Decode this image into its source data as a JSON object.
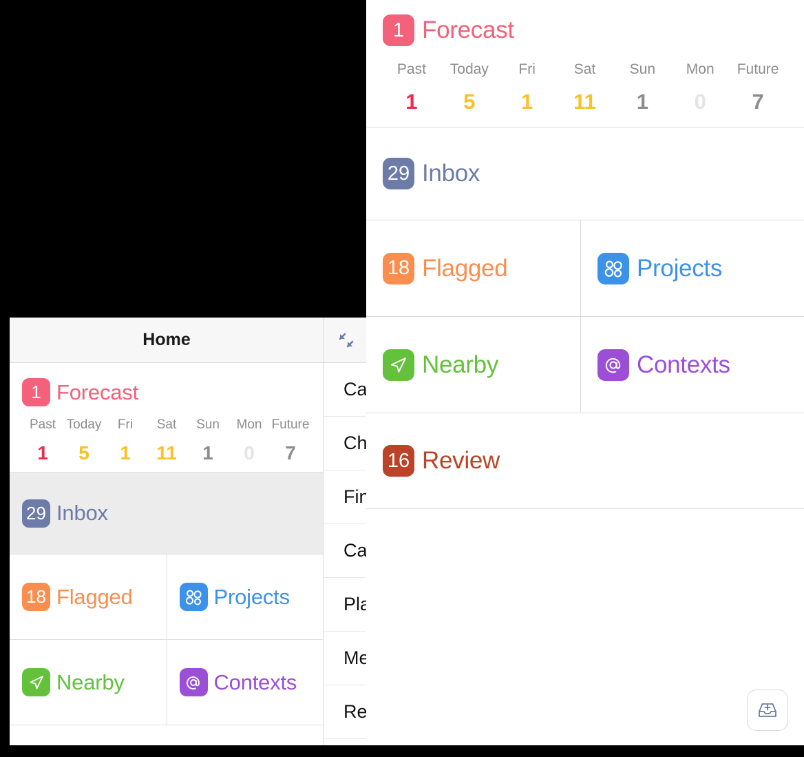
{
  "colors": {
    "forecast": "#F4617A",
    "inbox": "#6D7BA8",
    "flagged": "#F98E4F",
    "projects": "#3C92E8",
    "nearby": "#63C13B",
    "contexts": "#9B4FD6",
    "review": "#BC4328",
    "day_grey": "#8d8d8d",
    "day_faint": "#e4e4e4",
    "overdue_red": "#ED2B4F",
    "due_amber": "#FDC026"
  },
  "background_window": {
    "title": "Home",
    "expand_icon": "expand-diagonal-icon",
    "forecast": {
      "badge": "1",
      "label": "Forecast",
      "days": [
        {
          "day": "Past",
          "count": "1",
          "color": "#ED2B4F"
        },
        {
          "day": "Today",
          "count": "5",
          "color": "#FDC026"
        },
        {
          "day": "Fri",
          "count": "1",
          "color": "#FDC026"
        },
        {
          "day": "Sat",
          "count": "11",
          "color": "#FDC026"
        },
        {
          "day": "Sun",
          "count": "1",
          "color": "#8d8d8d"
        },
        {
          "day": "Mon",
          "count": "0",
          "color": "#e4e4e4"
        },
        {
          "day": "Future",
          "count": "7",
          "color": "#8d8d8d"
        }
      ]
    },
    "inbox": {
      "badge": "29",
      "label": "Inbox",
      "selected": true
    },
    "flagged": {
      "badge": "18",
      "label": "Flagged"
    },
    "projects": {
      "icon": "projects-circles-icon",
      "label": "Projects"
    },
    "nearby": {
      "icon": "navigation-arrow-icon",
      "label": "Nearby"
    },
    "contexts": {
      "icon": "at-sign-icon",
      "label": "Contexts"
    },
    "task_list": [
      "Call",
      "Cha",
      "Find",
      "Call",
      "Plan",
      "Mee",
      "Rem"
    ]
  },
  "panel": {
    "forecast": {
      "badge": "1",
      "label": "Forecast",
      "days": [
        {
          "day": "Past",
          "count": "1",
          "color": "#ED2B4F"
        },
        {
          "day": "Today",
          "count": "5",
          "color": "#FDC026"
        },
        {
          "day": "Fri",
          "count": "1",
          "color": "#FDC026"
        },
        {
          "day": "Sat",
          "count": "11",
          "color": "#FDC026"
        },
        {
          "day": "Sun",
          "count": "1",
          "color": "#8d8d8d"
        },
        {
          "day": "Mon",
          "count": "0",
          "color": "#e4e4e4"
        },
        {
          "day": "Future",
          "count": "7",
          "color": "#8d8d8d"
        }
      ]
    },
    "inbox": {
      "badge": "29",
      "label": "Inbox"
    },
    "flagged": {
      "badge": "18",
      "label": "Flagged"
    },
    "projects": {
      "icon": "projects-circles-icon",
      "label": "Projects"
    },
    "nearby": {
      "icon": "navigation-arrow-icon",
      "label": "Nearby"
    },
    "contexts": {
      "icon": "at-sign-icon",
      "label": "Contexts"
    },
    "review": {
      "badge": "16",
      "label": "Review"
    },
    "new_item_button": {
      "icon": "inbox-tray-plus-icon"
    }
  }
}
